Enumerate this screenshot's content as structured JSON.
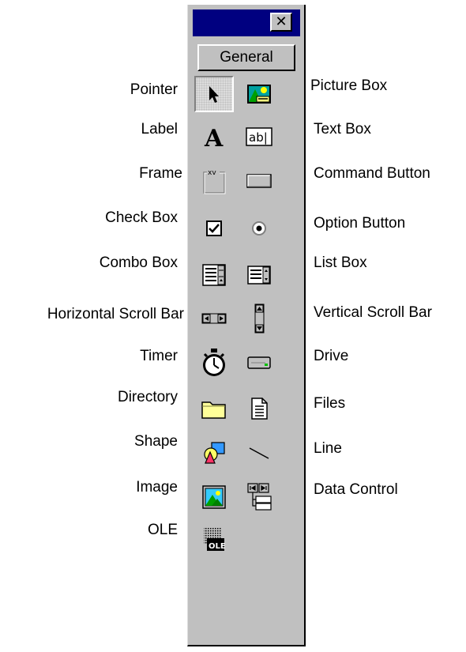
{
  "toolbox": {
    "close_glyph": "✕",
    "tab_label": "General",
    "left_labels": {
      "pointer": "Pointer",
      "label": "Label",
      "frame": "Frame",
      "check_box": "Check Box",
      "combo_box": "Combo Box",
      "hscroll": "Horizontal Scroll Bar",
      "timer": "Timer",
      "directory": "Directory",
      "shape": "Shape",
      "image": "Image",
      "ole": "OLE"
    },
    "right_labels": {
      "picture_box": "Picture Box",
      "text_box": "Text Box",
      "command_button": "Command Button",
      "option_button": "Option Button",
      "list_box": "List Box",
      "vscroll": "Vertical Scroll Bar",
      "drive": "Drive",
      "files": "Files",
      "line": "Line",
      "data_control": "Data Control"
    },
    "icon_text": {
      "label_glyph": "A",
      "textbox_glyph": "ab|",
      "frame_glyph": "xv",
      "ole_glyph": "OLE"
    },
    "colors": {
      "toolbox_bg": "#c0c0c0",
      "titlebar": "#000080"
    }
  }
}
